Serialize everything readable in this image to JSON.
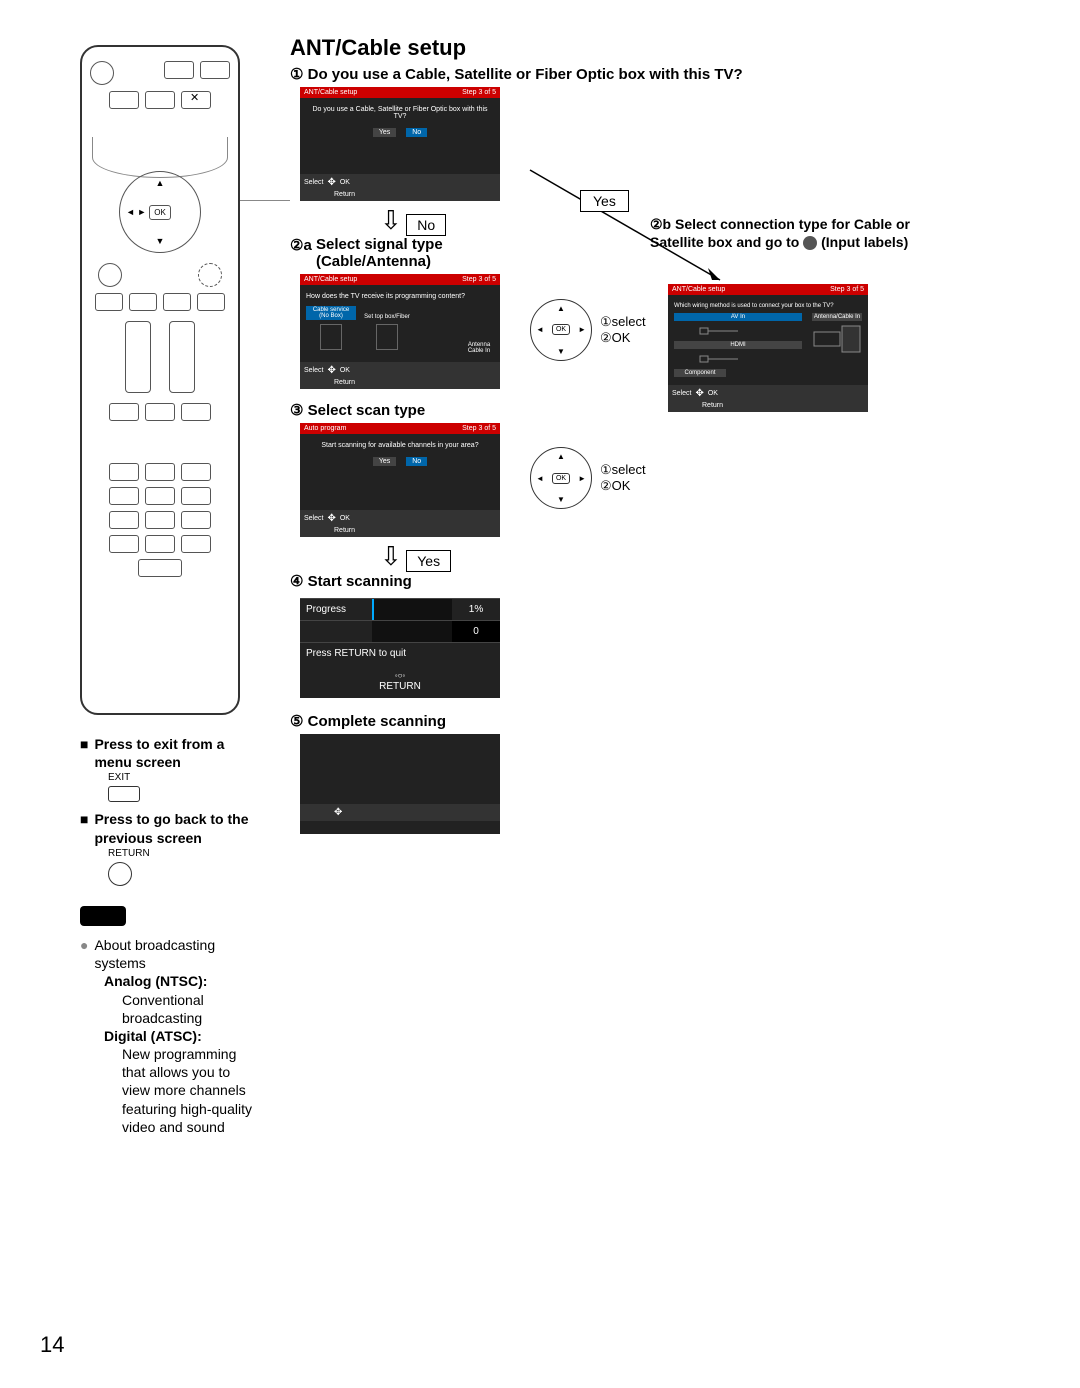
{
  "page_number": "14",
  "title": "ANT/Cable setup",
  "step1": {
    "num": "①",
    "text": "Do you use a Cable, Satellite or Fiber Optic box with this TV?"
  },
  "screen1": {
    "header": "ANT/Cable setup",
    "step": "Step 3 of 5",
    "q": "Do you use a Cable, Satellite or Fiber Optic box with this TV?",
    "yes": "Yes",
    "no": "No",
    "select": "Select",
    "ok": "OK",
    "return": "Return"
  },
  "no_label": "No",
  "yes_label": "Yes",
  "step2a": {
    "num": "②a",
    "text": "Select signal type (Cable/Antenna)"
  },
  "screen2a": {
    "header": "ANT/Cable setup",
    "step": "Step 3 of 5",
    "q": "How does the TV receive its programming content?",
    "opt1": "Cable service\n(No Box)",
    "opt2": "Set top box/Fiber",
    "opt3": "Antenna\nCable In",
    "select": "Select",
    "ok": "OK",
    "return": "Return"
  },
  "step2b": {
    "num": "②b",
    "text": "Select connection type for Cable or Satellite box and go to ",
    "circle": "●",
    "trail": "(Input labels)"
  },
  "screen2b": {
    "header": "ANT/Cable setup",
    "step": "Step 3 of 5",
    "q": "Which wiring method is used to connect your box to the TV?",
    "opt1": "AV In",
    "opt2": "Antenna/Cable In",
    "opt3": "HDMI",
    "select": "Select",
    "ok": "OK",
    "return": "Return"
  },
  "dpad": {
    "ok": "OK",
    "select_label": "①select",
    "ok_label": "②OK"
  },
  "step3": {
    "num": "③",
    "text": "Select scan type"
  },
  "screen3": {
    "header": "Auto program",
    "step": "Step 3 of 5",
    "q": "Start scanning for available channels in your area?",
    "yes": "Yes",
    "no": "No",
    "select": "Select",
    "ok": "OK",
    "return": "Return"
  },
  "yes_label2": "Yes",
  "step4": {
    "num": "④",
    "text": "Start scanning"
  },
  "progress": {
    "label": "Progress",
    "pct": "1%",
    "count": "0",
    "quit": "Press RETURN to quit",
    "return": "RETURN"
  },
  "step5": {
    "num": "⑤",
    "text": "Complete scanning"
  },
  "screen5": {},
  "remote_notes": {
    "exit_title": "Press to exit from a menu screen",
    "exit_label": "EXIT",
    "return_title": "Press to go back to the previous screen",
    "return_label": "RETURN",
    "about": "About broadcasting systems",
    "analog_t": "Analog (NTSC):",
    "analog_b": "Conventional broadcasting",
    "digital_t": "Digital (ATSC):",
    "digital_b": "New programming that allows you to view more channels featuring high-quality video and sound"
  }
}
